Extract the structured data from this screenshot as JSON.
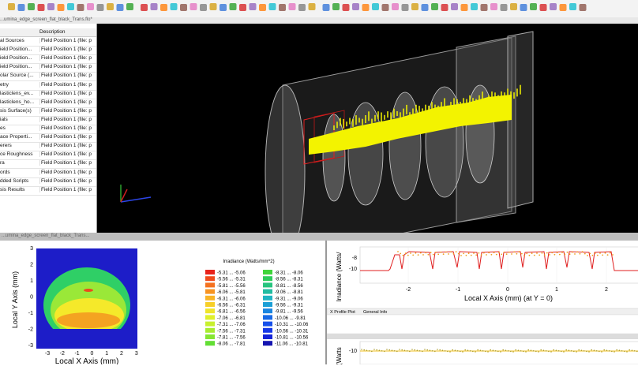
{
  "toolbar": {
    "title_fragment": "...umina_edge_screen_flat_black_Trans.flo*",
    "right_letters": "T T Y Y T M T"
  },
  "tree": {
    "header": "Description",
    "rows": [
      {
        "name": "al Sources",
        "desc": "Field Position 1 (file: p"
      },
      {
        "name": "ield Position...",
        "desc": "Field Position 1 (file: p"
      },
      {
        "name": "ield Position...",
        "desc": "Field Position 1 (file: p"
      },
      {
        "name": "ield Position...",
        "desc": "Field Position 1 (file: p"
      },
      {
        "name": "olar Source (...",
        "desc": "Field Position 1 (file: p"
      },
      {
        "name": "etry",
        "desc": "Field Position 1 (file: p"
      },
      {
        "name": "lasticlens_ev...",
        "desc": "Field Position 1 (file: p"
      },
      {
        "name": "lasticlens_ho...",
        "desc": "Field Position 1 (file: p"
      },
      {
        "name": "sis Surface(s)",
        "desc": "Field Position 1 (file: p"
      },
      {
        "name": "ials",
        "desc": "Field Position 1 (file: p"
      },
      {
        "name": "es",
        "desc": "Field Position 1 (file: p"
      },
      {
        "name": "ace Properti...",
        "desc": "Field Position 1 (file: p"
      },
      {
        "name": "erers",
        "desc": "Field Position 1 (file: p"
      },
      {
        "name": "ce Roughness",
        "desc": "Field Position 1 (file: p"
      },
      {
        "name": "ra",
        "desc": "Field Position 1 (file: p"
      },
      {
        "name": "ords",
        "desc": "Field Position 1 (file: p"
      },
      {
        "name": "dded Scripts",
        "desc": "Field Position 1 (file: p"
      },
      {
        "name": "sis Results",
        "desc": "Field Position 1 (file: p"
      }
    ]
  },
  "divider_label": "...umina_edge_screen_flat_black_Trans...",
  "irradiance_map": {
    "xlabel": "Local X Axis (mm)",
    "ylabel": "Local Y Axis (mm)",
    "xticks": [
      "-3",
      "-2",
      "-1",
      "0",
      "1",
      "2",
      "3"
    ],
    "yticks": [
      "3",
      "2",
      "1",
      "0",
      "-1",
      "-2",
      "-3"
    ],
    "legend_title": "Irradiance (Watts/mm^2)",
    "legend_left": [
      {
        "label": "-5.31 ... -5.06",
        "color": "#e8221b"
      },
      {
        "label": "-5.56 ... -5.31",
        "color": "#f04a1c"
      },
      {
        "label": "-5.81 ... -5.56",
        "color": "#f4711f"
      },
      {
        "label": "-6.06 ... -5.81",
        "color": "#f79422"
      },
      {
        "label": "-6.31 ... -6.06",
        "color": "#f9b425"
      },
      {
        "label": "-6.56 ... -6.31",
        "color": "#f7cf27"
      },
      {
        "label": "-6.81 ... -6.56",
        "color": "#efe52a"
      },
      {
        "label": "-7.06 ... -6.81",
        "color": "#e0f02c"
      },
      {
        "label": "-7.31 ... -7.06",
        "color": "#c8f02e"
      },
      {
        "label": "-7.56 ... -7.31",
        "color": "#a8ec30"
      },
      {
        "label": "-7.81 ... -7.56",
        "color": "#86e632"
      },
      {
        "label": "-8.06 ... -7.81",
        "color": "#62de34"
      }
    ],
    "legend_right": [
      {
        "label": "-8.31 ... -8.06",
        "color": "#3fd53a"
      },
      {
        "label": "-8.56 ... -8.31",
        "color": "#2dcc5a"
      },
      {
        "label": "-8.81 ... -8.56",
        "color": "#26c47e"
      },
      {
        "label": "-9.06 ... -8.81",
        "color": "#21bca1"
      },
      {
        "label": "-9.31 ... -9.06",
        "color": "#1eb4c2"
      },
      {
        "label": "-9.56 ... -9.31",
        "color": "#1b9fd6"
      },
      {
        "label": "-9.81 ... -9.56",
        "color": "#1985e0"
      },
      {
        "label": "-10.06 ... -9.81",
        "color": "#186ae6"
      },
      {
        "label": "-10.31 ... -10.06",
        "color": "#1650ea"
      },
      {
        "label": "-10.56 ... -10.31",
        "color": "#1538e8"
      },
      {
        "label": "-10.81 ... -10.56",
        "color": "#1424d8"
      },
      {
        "label": "-11.06 ... -10.81",
        "color": "#1414b0"
      }
    ]
  },
  "x_profile": {
    "ylabel": "Irradiance (Watts/",
    "xlabel": "Local X Axis (mm) (at Y = 0)",
    "xticks": [
      "-2",
      "-1",
      "0",
      "1",
      "2"
    ],
    "yticks": [
      "-8",
      "-10"
    ],
    "tab1": "X Profile Plot",
    "tab2": "General Info"
  },
  "y_profile": {
    "ylabel": "ce (Watts",
    "yticks": [
      "-10"
    ]
  }
}
